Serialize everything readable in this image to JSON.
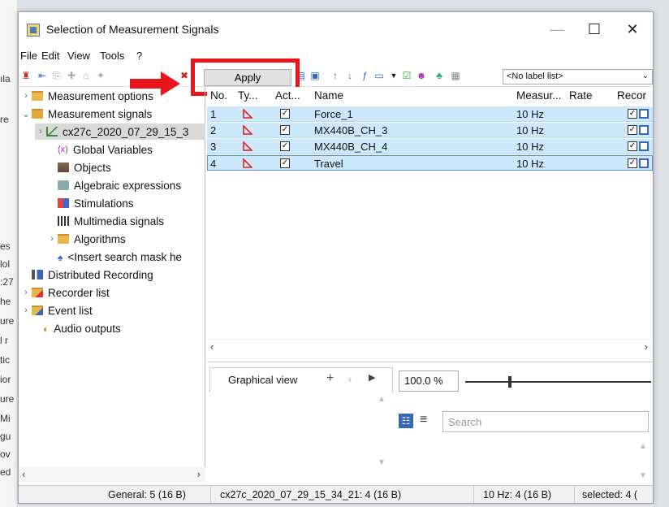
{
  "window": {
    "title": "Selection of Measurement Signals",
    "minimize": "—",
    "maximize": "☐",
    "close": "✕"
  },
  "menu": [
    "File",
    "Edit",
    "View",
    "Tools",
    "?"
  ],
  "toolbar": {
    "apply_label": "Apply",
    "label_list": "<No label list>"
  },
  "tree": {
    "items": [
      {
        "label": "Measurement options",
        "expander": "›"
      },
      {
        "label": "Measurement signals",
        "expander": "⌄"
      },
      {
        "label": "cx27c_2020_07_29_15_3",
        "expander": "›"
      },
      {
        "label": "Global Variables"
      },
      {
        "label": "Objects"
      },
      {
        "label": "Algebraic expressions"
      },
      {
        "label": "Stimulations"
      },
      {
        "label": "Multimedia signals"
      },
      {
        "label": "Algorithms",
        "expander": "›"
      },
      {
        "label": "<Insert search mask he"
      },
      {
        "label": "Distributed Recording"
      },
      {
        "label": "Recorder list",
        "expander": "›"
      },
      {
        "label": "Event list",
        "expander": "›"
      },
      {
        "label": "Audio outputs"
      }
    ]
  },
  "grid": {
    "columns": [
      "No.",
      "Ty...",
      "Act...",
      "Name",
      "Measur...",
      "Rate",
      "Recor"
    ],
    "rows": [
      {
        "no": "1",
        "name": "Force_1",
        "measure": "10 Hz",
        "active": "✓"
      },
      {
        "no": "2",
        "name": "MX440B_CH_3",
        "measure": "10 Hz",
        "active": "✓"
      },
      {
        "no": "3",
        "name": "MX440B_CH_4",
        "measure": "10 Hz",
        "active": "✓"
      },
      {
        "no": "4",
        "name": "Travel",
        "measure": "10 Hz",
        "active": "✓"
      }
    ]
  },
  "bottom": {
    "tab_label": "Graphical view",
    "add": "+",
    "zoom": "100.0 %",
    "search_placeholder": "Search"
  },
  "status": {
    "general": "General: 5 (16 B)",
    "file": "cx27c_2020_07_29_15_34_21: 4 (16 B)",
    "rate": "10 Hz: 4 (16 B)",
    "selected": "selected: 4 ("
  },
  "background_left": [
    "ıla",
    "re",
    "es",
    "lol",
    ":27",
    "he",
    "ure",
    "l r",
    "tic",
    "ior",
    "ure",
    "Mi",
    "gu",
    "ov",
    "ed"
  ],
  "colors": {
    "selection": "#cde8fb",
    "highlight": "#e8151d",
    "folder": "#e8b84a"
  }
}
